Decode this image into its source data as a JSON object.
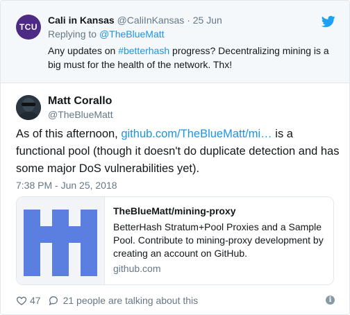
{
  "reply_tweet": {
    "avatar_text": "TCU",
    "name": "Cali in Kansas",
    "handle": "@CaliInKansas",
    "separator": "·",
    "date": "25 Jun",
    "replying_prefix": "Replying to",
    "replying_to": "@TheBlueMatt",
    "text_before": "Any updates on ",
    "hashtag": "#betterhash",
    "text_after": " progress?  Decentralizing mining is a big must for the health of the network. Thx!"
  },
  "main_tweet": {
    "name": "Matt Corallo",
    "handle": "@TheBlueMatt",
    "text_before": "As of this afternoon, ",
    "link": "github.com/TheBlueMatt/mi…",
    "text_after": " is a functional pool (though it doesn't do duplicate detection and has some major DoS vulnerabilities yet).",
    "timestamp": "7:38 PM - Jun 25, 2018"
  },
  "card": {
    "title": "TheBlueMatt/mining-proxy",
    "description": "BetterHash Stratum+Pool Proxies and a Sample Pool. Contribute to mining-proxy development by creating an account on GitHub.",
    "domain": "github.com"
  },
  "footer": {
    "likes": "47",
    "talking": "21 people are talking about this"
  },
  "colors": {
    "link": "#1b95e0",
    "muted": "#657786",
    "tcu_purple": "#4d2a84",
    "identicon": "#5b7fe0"
  }
}
